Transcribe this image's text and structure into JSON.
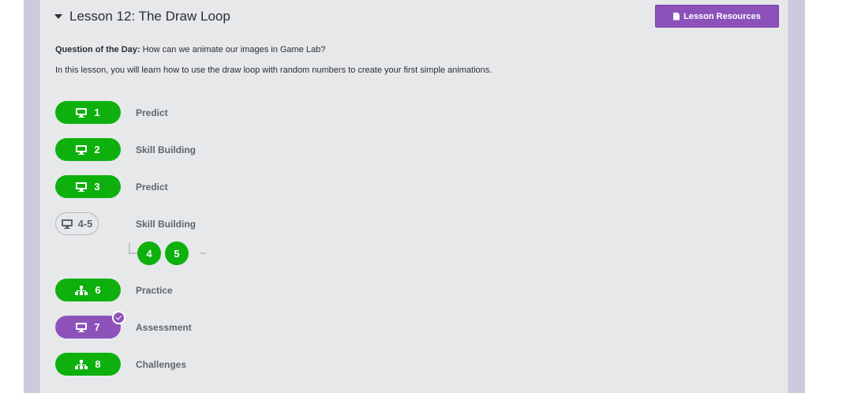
{
  "lesson": {
    "title": "Lesson 12: The Draw Loop",
    "resources_label": "Lesson Resources",
    "question_label": "Question of the Day:",
    "question_text": " How can we animate our images in Game Lab?",
    "intro": "In this lesson, you will learn how to use the draw loop with random numbers to create your first simple animations."
  },
  "levels": [
    {
      "number": "1",
      "label": "Predict",
      "icon": "monitor-icon",
      "status": "completed"
    },
    {
      "number": "2",
      "label": "Skill Building",
      "icon": "monitor-icon",
      "status": "completed"
    },
    {
      "number": "3",
      "label": "Predict",
      "icon": "monitor-icon",
      "status": "completed"
    },
    {
      "number": "4-5",
      "label": "Skill Building",
      "icon": "monitor-icon",
      "status": "not-started",
      "sublevels": [
        "4",
        "5"
      ]
    },
    {
      "number": "6",
      "label": "Practice",
      "icon": "sitemap-icon",
      "status": "completed"
    },
    {
      "number": "7",
      "label": "Assessment",
      "icon": "monitor-icon",
      "status": "submitted"
    },
    {
      "number": "8",
      "label": "Challenges",
      "icon": "sitemap-icon",
      "status": "completed"
    }
  ],
  "colors": {
    "completed": "#0eb00e",
    "submitted": "#8c52ba",
    "background": "#e7e8ea"
  }
}
